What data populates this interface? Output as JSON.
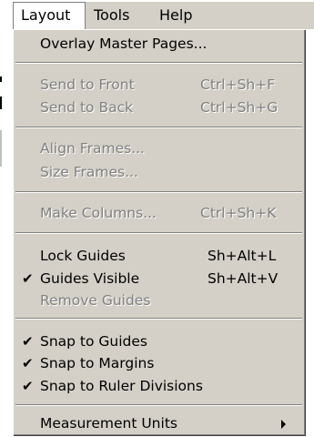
{
  "menubar": {
    "items": [
      {
        "label": "Layout"
      },
      {
        "label": "Tools"
      },
      {
        "label": "Help"
      }
    ]
  },
  "menu": {
    "overlay_master_pages": {
      "label": "Overlay Master Pages..."
    },
    "send_to_front": {
      "label": "Send to Front",
      "shortcut": "Ctrl+Sh+F"
    },
    "send_to_back": {
      "label": "Send to Back",
      "shortcut": "Ctrl+Sh+G"
    },
    "align_frames": {
      "label": "Align Frames..."
    },
    "size_frames": {
      "label": "Size Frames..."
    },
    "make_columns": {
      "label": "Make Columns...",
      "shortcut": "Ctrl+Sh+K"
    },
    "lock_guides": {
      "label": "Lock Guides",
      "shortcut": "Sh+Alt+L"
    },
    "guides_visible": {
      "label": "Guides Visible",
      "shortcut": "Sh+Alt+V",
      "check": "✔"
    },
    "remove_guides": {
      "label": "Remove Guides"
    },
    "snap_to_guides": {
      "label": "Snap to Guides",
      "check": "✔"
    },
    "snap_to_margins": {
      "label": "Snap to Margins",
      "check": "✔"
    },
    "snap_to_ruler_divisions": {
      "label": "Snap to Ruler Divisions",
      "check": "✔"
    },
    "measurement_units": {
      "label": "Measurement Units",
      "icon": "submenu-arrow-icon"
    }
  }
}
